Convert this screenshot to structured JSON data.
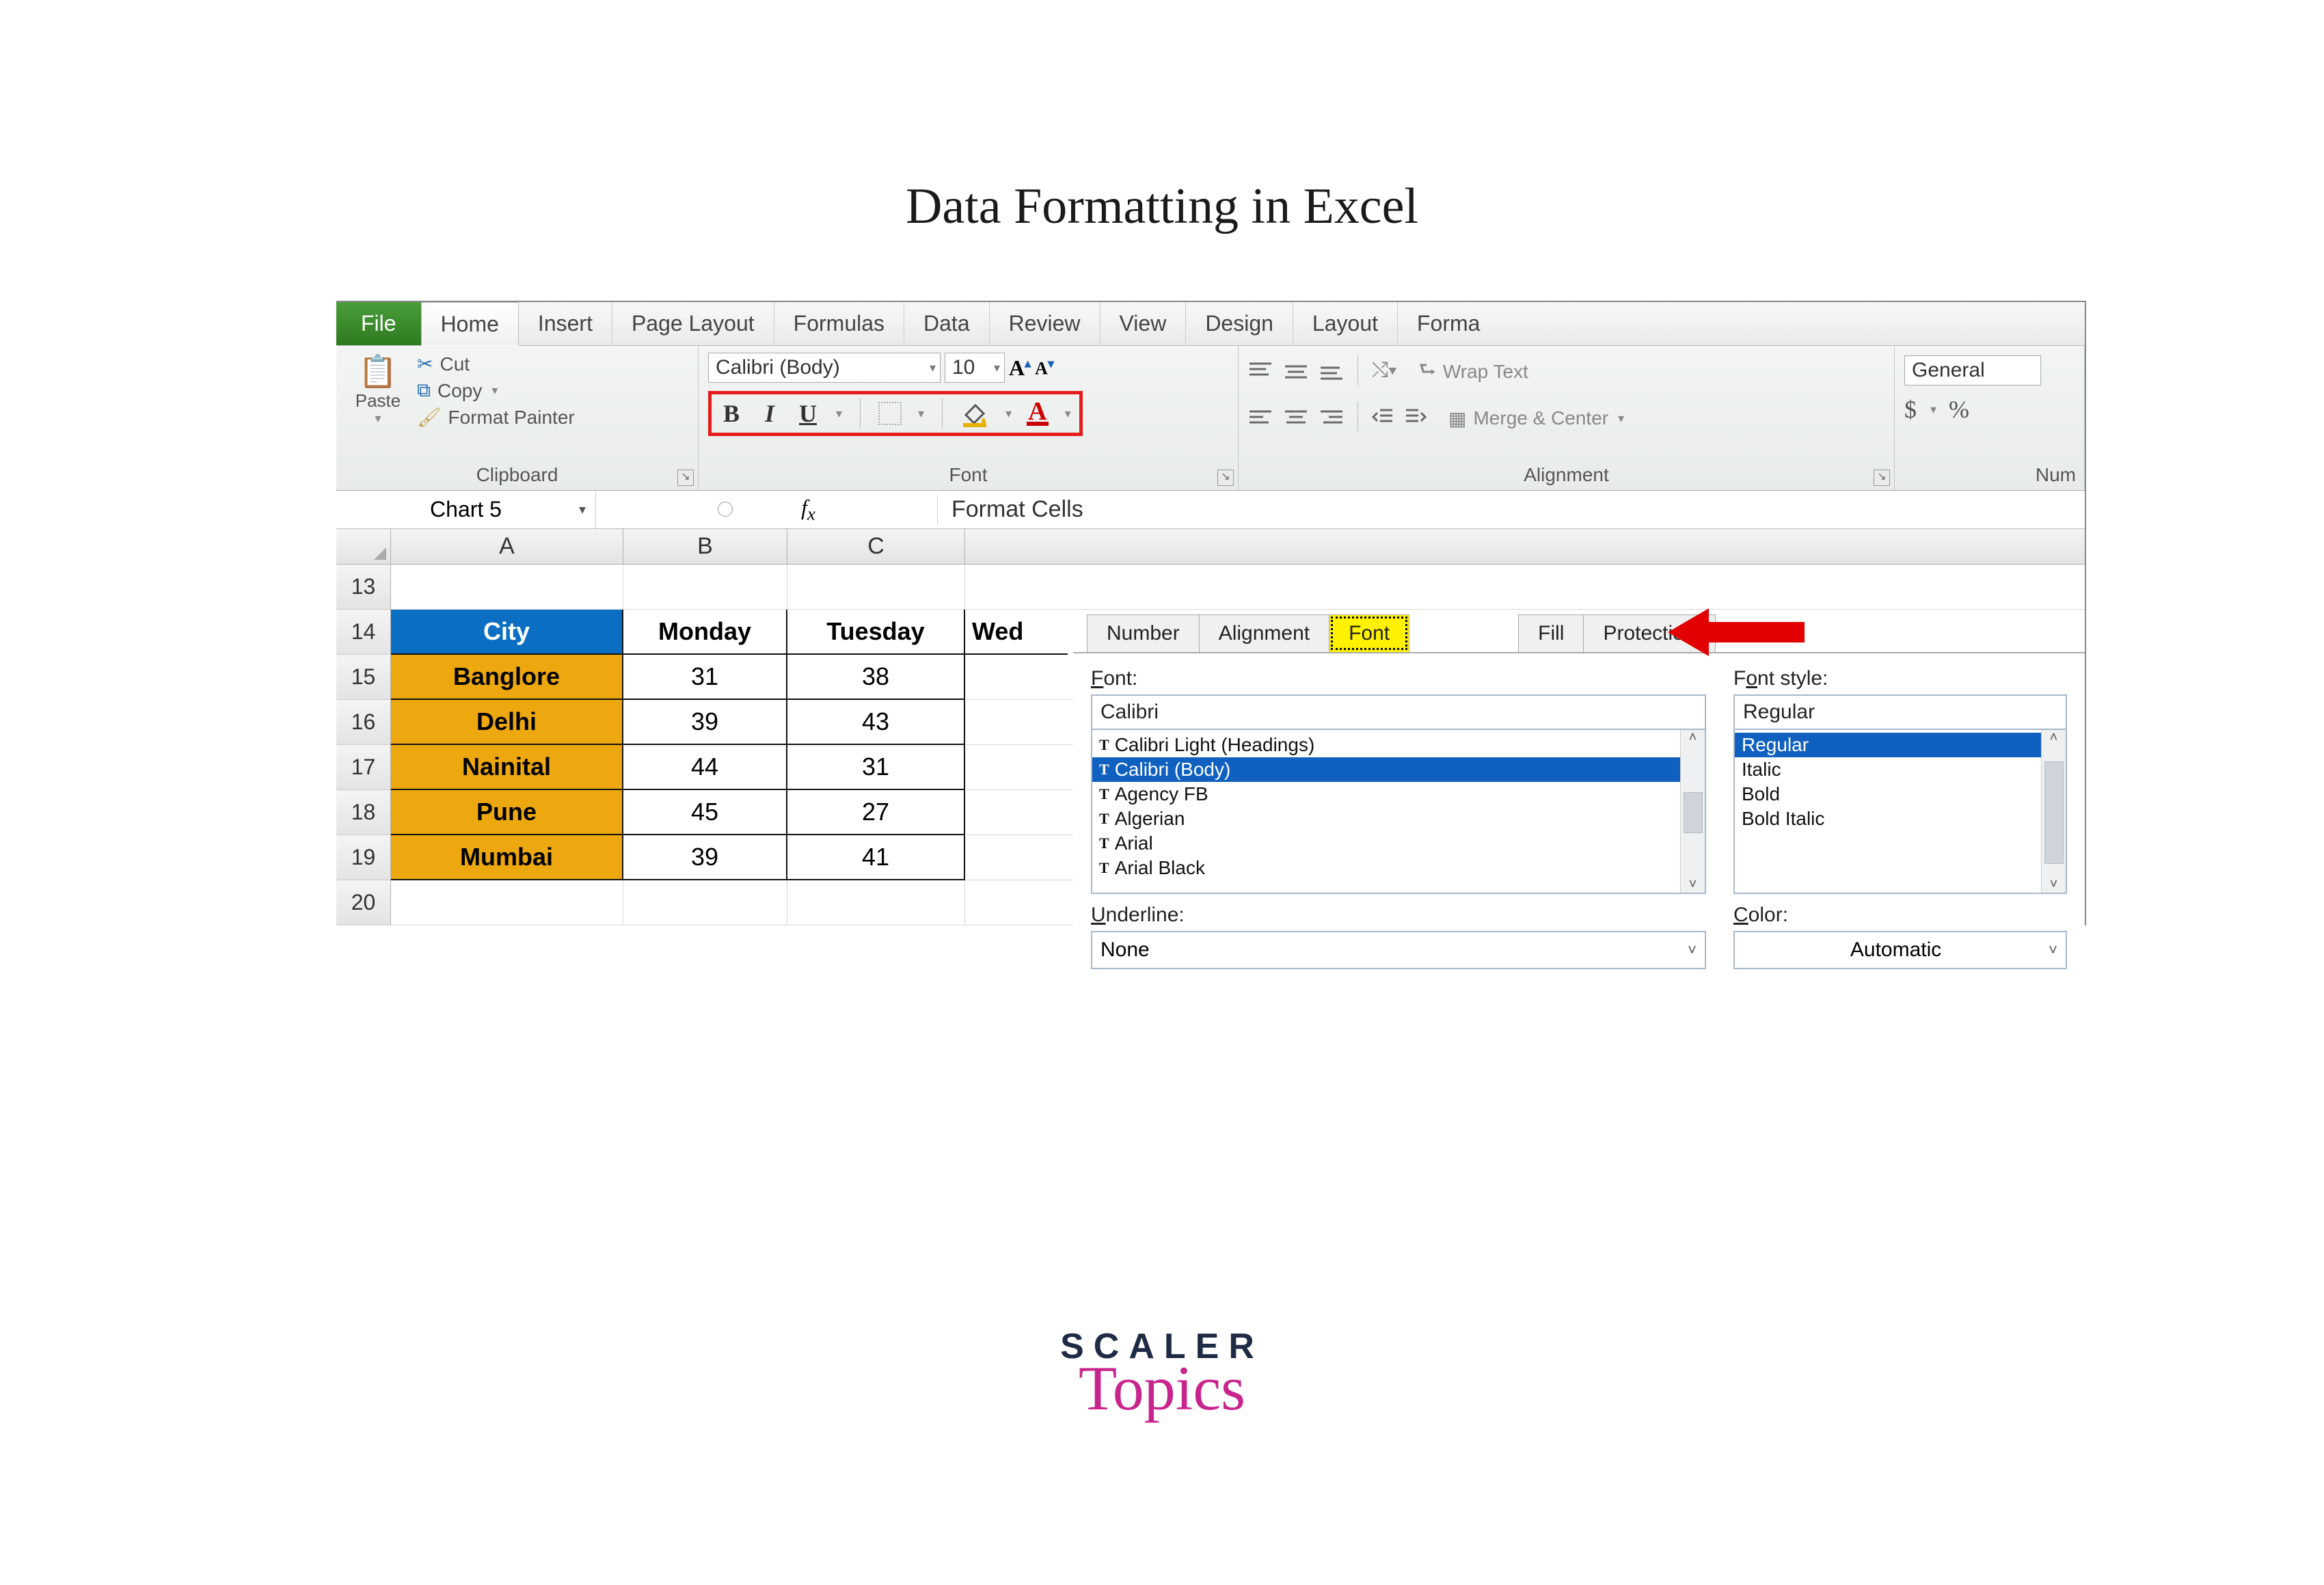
{
  "page_title": "Data Formatting in Excel",
  "tabs": {
    "file": "File",
    "home": "Home",
    "insert": "Insert",
    "page_layout": "Page Layout",
    "formulas": "Formulas",
    "data": "Data",
    "review": "Review",
    "view": "View",
    "design": "Design",
    "layout": "Layout",
    "format": "Forma"
  },
  "clipboard": {
    "paste": "Paste",
    "cut": "Cut",
    "copy": "Copy",
    "fp": "Format Painter",
    "label": "Clipboard"
  },
  "font": {
    "name": "Calibri (Body)",
    "size": "10",
    "label": "Font"
  },
  "alignment": {
    "wrap": "Wrap Text",
    "merge": "Merge & Center",
    "label": "Alignment"
  },
  "number": {
    "general": "General",
    "label": "Num"
  },
  "namebox": "Chart 5",
  "dialog_title": "Format Cells",
  "columns": {
    "A": "A",
    "B": "B",
    "C": "C"
  },
  "rows": [
    "13",
    "14",
    "15",
    "16",
    "17",
    "18",
    "19",
    "20"
  ],
  "table": {
    "headers": {
      "city": "City",
      "mon": "Monday",
      "tue": "Tuesday",
      "wed": "Wed"
    },
    "data": [
      {
        "city": "Banglore",
        "mon": "31",
        "tue": "38"
      },
      {
        "city": "Delhi",
        "mon": "39",
        "tue": "43"
      },
      {
        "city": "Nainital",
        "mon": "44",
        "tue": "31"
      },
      {
        "city": "Pune",
        "mon": "45",
        "tue": "27"
      },
      {
        "city": "Mumbai",
        "mon": "39",
        "tue": "41"
      }
    ]
  },
  "dlg": {
    "tabs": {
      "number": "Number",
      "alignment": "Alignment",
      "font": "Font",
      "fill": "Fill",
      "protection": "Protection"
    },
    "font_label": "Font:",
    "font_value": "Calibri",
    "fonts": [
      "Calibri Light (Headings)",
      "Calibri (Body)",
      "Agency FB",
      "Algerian",
      "Arial",
      "Arial Black"
    ],
    "style_label": "Font style:",
    "style_value": "Regular",
    "styles": [
      "Regular",
      "Italic",
      "Bold",
      "Bold Italic"
    ],
    "underline_label": "Underline:",
    "underline_value": "None",
    "color_label": "Color:",
    "color_value": "Automatic"
  },
  "logo": {
    "line1": "SCALER",
    "line2": "Topics"
  }
}
